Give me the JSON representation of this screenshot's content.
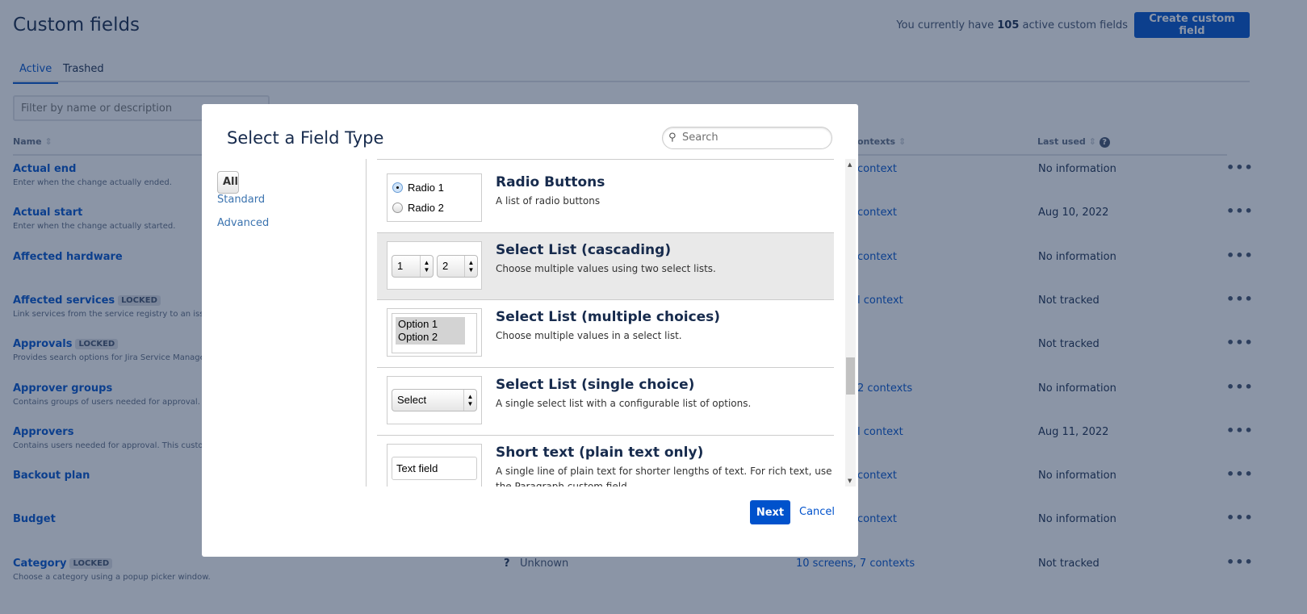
{
  "page": {
    "title": "Custom fields",
    "count_prefix": "You currently have",
    "count": "105",
    "count_suffix": "active custom fields",
    "create_label": "Create custom field",
    "tabs": [
      "Active",
      "Trashed"
    ],
    "filter_placeholder": "Filter by name or description",
    "columns": {
      "name": "Name",
      "contexts": "ontexts",
      "last_used": "Last used"
    },
    "rows": [
      {
        "name": "Actual end",
        "locked": "",
        "desc": "Enter when the change actually ended.",
        "ctx": "context",
        "last": "No information"
      },
      {
        "name": "Actual start",
        "locked": "",
        "desc": "Enter when the change actually started.",
        "ctx": "context",
        "last": "Aug 10, 2022"
      },
      {
        "name": "Affected hardware",
        "locked": "",
        "desc": "",
        "ctx": " context",
        "last": "No information"
      },
      {
        "name": "Affected services",
        "locked": "LOCKED",
        "desc": "Link services from the service registry to an issue.",
        "ctx": "l context",
        "last": "Not tracked"
      },
      {
        "name": "Approvals",
        "locked": "LOCKED",
        "desc": "Provides search options for Jira Service Managem",
        "ctx": "",
        "last": "Not tracked"
      },
      {
        "name": "Approver groups",
        "locked": "",
        "desc": "Contains groups of users needed for approval. Thi",
        "ctx": "2 contexts",
        "last": "No information"
      },
      {
        "name": "Approvers",
        "locked": "",
        "desc": "Contains users needed for approval. This custom f",
        "ctx": "l context",
        "last": "Aug 11, 2022"
      },
      {
        "name": "Backout plan",
        "locked": "",
        "desc": "",
        "ctx": "context",
        "last": "No information"
      },
      {
        "name": "Budget",
        "locked": "",
        "desc": "",
        "ctx": "context",
        "last": "No information"
      },
      {
        "name": "Category",
        "locked": "LOCKED",
        "desc": "Choose a category using a popup picker window.",
        "ctx": "10 screens, 7 contexts",
        "last": "Not tracked",
        "type": "Unknown"
      }
    ]
  },
  "modal": {
    "title": "Select a Field Type",
    "search_placeholder": "Search",
    "nav": [
      "All",
      "Standard",
      "Advanced"
    ],
    "items": [
      {
        "title": "Radio Buttons",
        "desc": "A list of radio buttons",
        "preview": [
          "Radio 1",
          "Radio 2"
        ]
      },
      {
        "title": "Select List (cascading)",
        "desc": "Choose multiple values using two select lists.",
        "preview": [
          "1",
          "2"
        ]
      },
      {
        "title": "Select List (multiple choices)",
        "desc": "Choose multiple values in a select list.",
        "preview": [
          "Option 1",
          "Option 2"
        ]
      },
      {
        "title": "Select List (single choice)",
        "desc": "A single select list with a configurable list of options.",
        "preview": [
          "Select"
        ]
      },
      {
        "title": "Short text (plain text only)",
        "desc": "A single line of plain text for shorter lengths of text. For rich text, use the Paragraph custom field.",
        "preview": [
          "Text field"
        ]
      }
    ],
    "next": "Next",
    "cancel": "Cancel"
  },
  "colors": {
    "accent": "#0052cc",
    "arrow": "#e8403a"
  }
}
